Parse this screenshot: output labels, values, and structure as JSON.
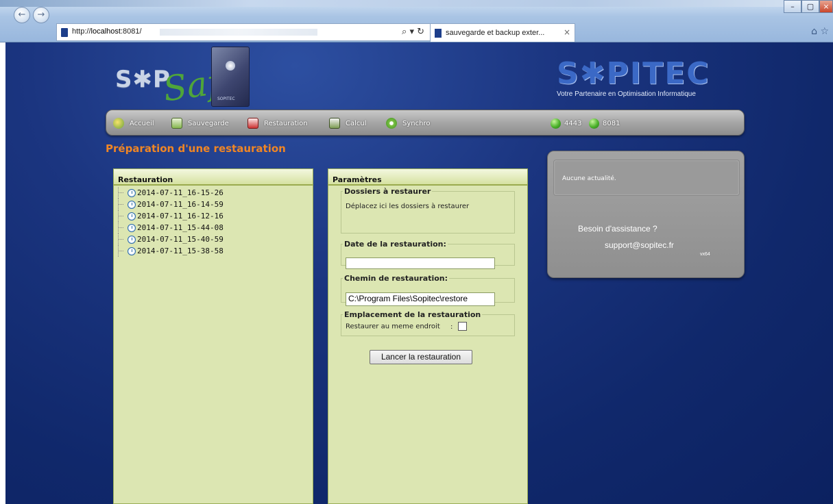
{
  "browser": {
    "url": "http://localhost:8081/",
    "url_host": "localhost",
    "url_prefix": "http://",
    "url_suffix": ":8081/",
    "search_tools": "⌕ ▾ ↻",
    "tab_title": "sauvegarde et backup exter...",
    "tab_close": "×",
    "back_glyph": "←",
    "forward_glyph": "→",
    "win_minimize": "–",
    "win_maximize": "▢",
    "win_close": "×",
    "home_star": "⌂ ☆"
  },
  "logos": {
    "left_prefix": "S✱P",
    "left_script": "Safe",
    "left_box_label": "SOPITEC",
    "right_brand": "S✱PITEC",
    "right_tagline": "Votre Partenaire en Optimisation Informatique"
  },
  "nav": {
    "items": [
      {
        "label": "Accueil",
        "icon": "home-icon"
      },
      {
        "label": "Sauvegarde",
        "icon": "backup-icon"
      },
      {
        "label": "Restauration",
        "icon": "restore-icon"
      },
      {
        "label": "Calcul",
        "icon": "calculator-icon"
      },
      {
        "label": "Synchro",
        "icon": "sync-icon"
      }
    ],
    "status": [
      {
        "label": "4443",
        "color": "#4bb12a"
      },
      {
        "label": "8081",
        "color": "#4bb12a"
      }
    ]
  },
  "page": {
    "title": "Préparation d'une restauration"
  },
  "restauration_panel": {
    "heading": "Restauration",
    "items": [
      "2014-07-11_16-15-26",
      "2014-07-11_16-14-59",
      "2014-07-11_16-12-16",
      "2014-07-11_15-44-08",
      "2014-07-11_15-40-59",
      "2014-07-11_15-38-58"
    ]
  },
  "parametres_panel": {
    "heading": "Paramètres",
    "dossiers": {
      "legend": "Dossiers à restaurer",
      "hint": "Déplacez ici les dossiers à restaurer"
    },
    "date": {
      "legend": "Date de la restauration:",
      "value": ""
    },
    "chemin": {
      "legend": "Chemin de restauration:",
      "value": "C:\\Program Files\\Sopitec\\restore"
    },
    "emplacement": {
      "legend": "Emplacement de la restauration",
      "label": "Restaurer au meme endroit",
      "colon": ":",
      "checked": false
    },
    "button_label": "Lancer la restauration"
  },
  "news": {
    "text": "Aucune actualité.",
    "help": "Besoin d'assistance ?",
    "email": "support@sopitec.fr",
    "version": "vx64"
  },
  "colors": {
    "page_bg": "#10286b",
    "title_orange": "#f08624",
    "panel_bg": "#dce6b2",
    "status_green": "#4bb12a"
  }
}
